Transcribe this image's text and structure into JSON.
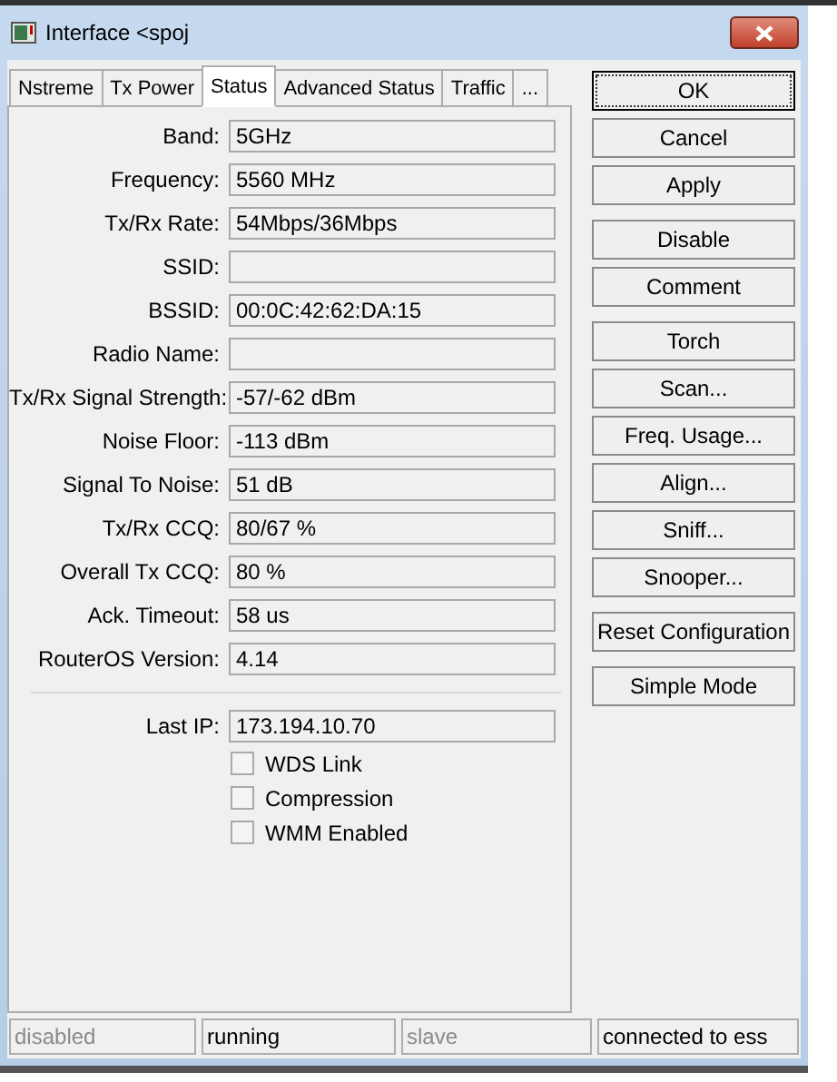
{
  "window": {
    "title": "Interface <spoj"
  },
  "tabs": [
    {
      "label": "Nstreme",
      "selected": false
    },
    {
      "label": "Tx Power",
      "selected": false
    },
    {
      "label": "Status",
      "selected": true
    },
    {
      "label": "Advanced Status",
      "selected": false
    },
    {
      "label": "Traffic",
      "selected": false
    },
    {
      "label": "...",
      "selected": false
    }
  ],
  "fields": [
    {
      "label": "Band:",
      "value": "5GHz"
    },
    {
      "label": "Frequency:",
      "value": "5560 MHz"
    },
    {
      "label": "Tx/Rx Rate:",
      "value": "54Mbps/36Mbps"
    },
    {
      "label": "SSID:"
    },
    {
      "label": "BSSID:",
      "value": "00:0C:42:62:DA:15"
    },
    {
      "label": "Radio Name:"
    },
    {
      "label": "Tx/Rx Signal Strength:",
      "value": "-57/-62 dBm"
    },
    {
      "label": "Noise Floor:",
      "value": "-113 dBm"
    },
    {
      "label": "Signal To Noise:",
      "value": "51 dB"
    },
    {
      "label": "Tx/Rx CCQ:",
      "value": "80/67 %"
    },
    {
      "label": "Overall Tx CCQ:",
      "value": "80 %"
    },
    {
      "label": "Ack. Timeout:",
      "value": "58 us"
    },
    {
      "label": "RouterOS Version:",
      "value": "4.14"
    }
  ],
  "last_ip": {
    "label": "Last IP:",
    "value": "173.194.10.70"
  },
  "checkboxes": [
    {
      "label": "WDS Link",
      "checked": false
    },
    {
      "label": "Compression",
      "checked": false
    },
    {
      "label": "WMM Enabled",
      "checked": false
    }
  ],
  "button_groups": [
    [
      {
        "label": "OK",
        "focused": true
      },
      {
        "label": "Cancel",
        "focused": false
      },
      {
        "label": "Apply",
        "focused": false
      }
    ],
    [
      {
        "label": "Disable",
        "focused": false
      },
      {
        "label": "Comment",
        "focused": false
      }
    ],
    [
      {
        "label": "Torch",
        "focused": false
      },
      {
        "label": "Scan...",
        "focused": false
      },
      {
        "label": "Freq. Usage...",
        "focused": false
      },
      {
        "label": "Align...",
        "focused": false
      },
      {
        "label": "Sniff...",
        "focused": false
      },
      {
        "label": "Snooper...",
        "focused": false
      }
    ],
    [
      {
        "label": "Reset Configuration",
        "focused": false
      }
    ],
    [
      {
        "label": "Simple Mode",
        "focused": false
      }
    ]
  ],
  "status_bar": [
    {
      "text": "disabled",
      "disabled": true
    },
    {
      "text": "running",
      "disabled": false
    },
    {
      "text": "slave",
      "disabled": true
    },
    {
      "text": "connected to ess",
      "disabled": false
    }
  ]
}
